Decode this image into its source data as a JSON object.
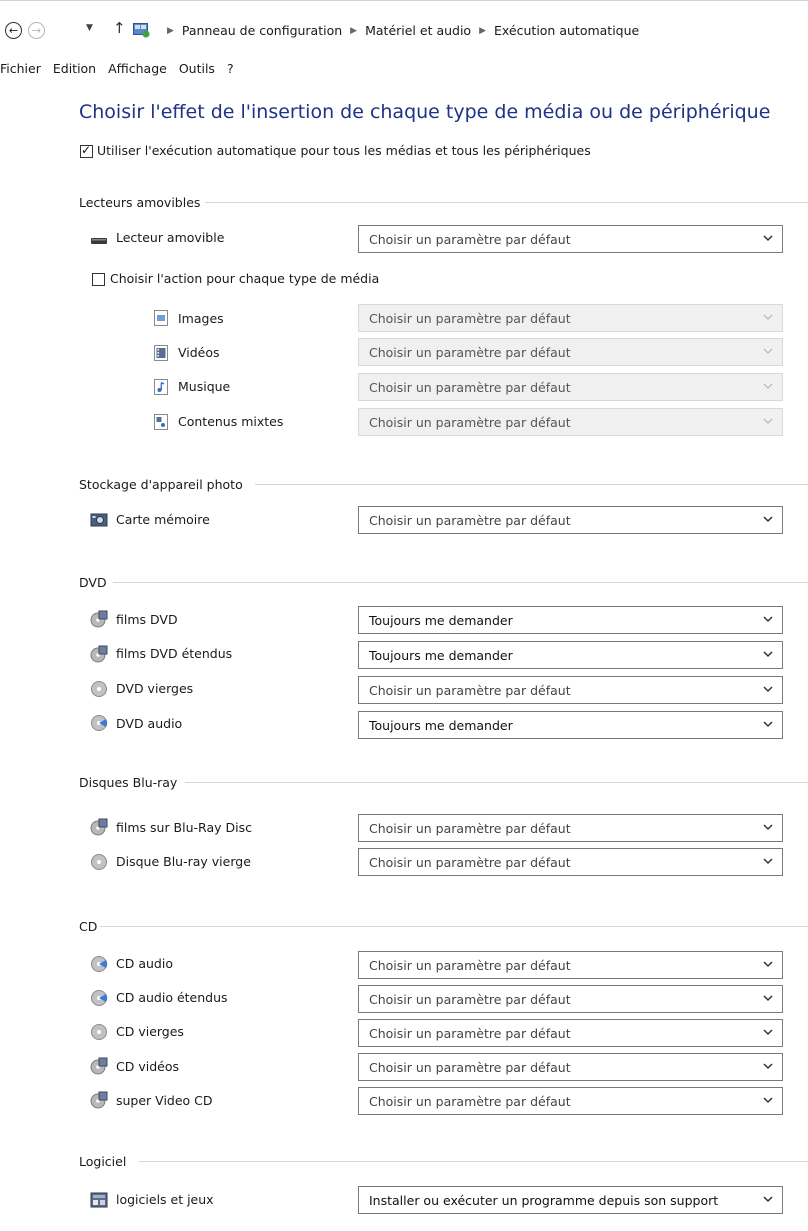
{
  "breadcrumb": [
    "Panneau de configuration",
    "Matériel et audio",
    "Exécution automatique"
  ],
  "menu": [
    "Fichier",
    "Edition",
    "Affichage",
    "Outils",
    "?"
  ],
  "page_title": "Choisir l'effet de l'insertion de chaque type de média ou de périphérique",
  "use_autoplay": {
    "label": "Utiliser l'exécution automatique pour tous les médias et tous les périphériques",
    "checked": true
  },
  "removable": {
    "header": "Lecteurs amovibles",
    "drive": {
      "label": "Lecteur amovible",
      "value": "Choisir un paramètre par défaut"
    },
    "per_media": {
      "label": "Choisir l'action pour chaque type de média",
      "checked": false
    },
    "items": [
      {
        "label": "Images",
        "value": "Choisir un paramètre par défaut"
      },
      {
        "label": "Vidéos",
        "value": "Choisir un paramètre par défaut"
      },
      {
        "label": "Musique",
        "value": "Choisir un paramètre par défaut"
      },
      {
        "label": "Contenus mixtes",
        "value": "Choisir un paramètre par défaut"
      }
    ]
  },
  "camera": {
    "header": "Stockage d'appareil photo",
    "items": [
      {
        "label": "Carte mémoire",
        "value": "Choisir un paramètre par défaut"
      }
    ]
  },
  "dvd": {
    "header": "DVD",
    "items": [
      {
        "label": "films DVD",
        "value": "Toujours me demander"
      },
      {
        "label": "films DVD étendus",
        "value": "Toujours me demander"
      },
      {
        "label": "DVD vierges",
        "value": "Choisir un paramètre par défaut"
      },
      {
        "label": "DVD audio",
        "value": "Toujours me demander"
      }
    ]
  },
  "bluray": {
    "header": "Disques Blu-ray",
    "items": [
      {
        "label": "films sur Blu-Ray Disc",
        "value": "Choisir un paramètre par défaut"
      },
      {
        "label": "Disque Blu-ray vierge",
        "value": "Choisir un paramètre par défaut"
      }
    ]
  },
  "cd": {
    "header": "CD",
    "items": [
      {
        "label": "CD audio",
        "value": "Choisir un paramètre par défaut"
      },
      {
        "label": "CD audio étendus",
        "value": "Choisir un paramètre par défaut"
      },
      {
        "label": "CD vierges",
        "value": "Choisir un paramètre par défaut"
      },
      {
        "label": "CD vidéos",
        "value": "Choisir un paramètre par défaut"
      },
      {
        "label": "super Video CD",
        "value": "Choisir un paramètre par défaut"
      }
    ]
  },
  "software": {
    "header": "Logiciel",
    "items": [
      {
        "label": "logiciels et jeux",
        "value": "Installer ou exécuter un programme depuis son support"
      }
    ]
  },
  "colors": {
    "title": "#1e3287",
    "separator": "#d6d6d6"
  }
}
